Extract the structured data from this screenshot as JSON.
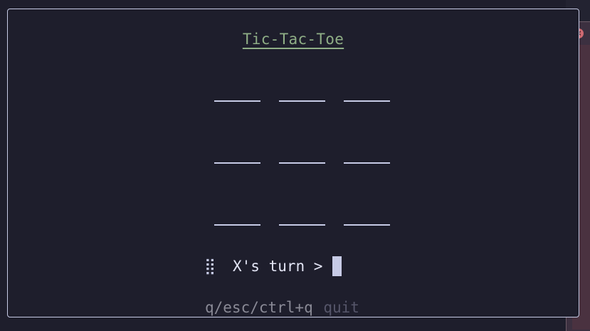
{
  "app": {
    "title": "Tic-Tac-Toe"
  },
  "board": {
    "cells": [
      "",
      "",
      "",
      "",
      "",
      "",
      "",
      "",
      ""
    ]
  },
  "status": {
    "spinner_glyph": "⣿",
    "turn_text": "X's turn >"
  },
  "help": {
    "keys": "q/esc/ctrl+q",
    "action": "quit"
  },
  "colors": {
    "background": "#1e1e2c",
    "border": "#c7cbe6",
    "title": "#8fae86",
    "text": "#e3e5f5",
    "help_key": "#8a8a96",
    "help_desc": "#56566a"
  }
}
